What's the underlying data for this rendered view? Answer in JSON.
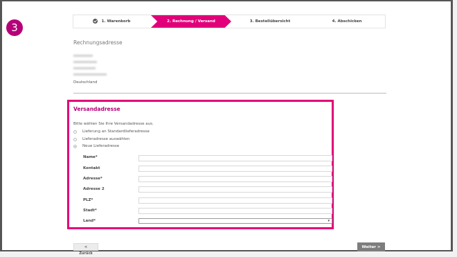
{
  "badge": "3",
  "stepper": {
    "steps": [
      {
        "label": "1. Warenkorb",
        "state": "done"
      },
      {
        "label": "2. Rechnung / Versand",
        "state": "active"
      },
      {
        "label": "3. Bestellübersicht",
        "state": "upcoming"
      },
      {
        "label": "4. Abschicken",
        "state": "upcoming"
      }
    ],
    "active_color": "#e2007a"
  },
  "billing": {
    "title": "Rechnungsadresse",
    "country": "Deutschland"
  },
  "shipping": {
    "title": "Versandadresse",
    "hint": "Bitte wählen Sie Ihre Versandadresse aus.",
    "options": [
      {
        "label": "Lieferung an Standardlieferadresse",
        "selected": false
      },
      {
        "label": "Lieferadresse auswählen",
        "selected": false
      },
      {
        "label": "Neue Lieferadresse",
        "selected": true
      }
    ],
    "fields": [
      {
        "label": "Name*",
        "value": ""
      },
      {
        "label": "Kontakt",
        "value": ""
      },
      {
        "label": "Adresse*",
        "value": ""
      },
      {
        "label": "Adresse 2",
        "value": ""
      },
      {
        "label": "PLZ*",
        "value": ""
      },
      {
        "label": "Stadt*",
        "value": ""
      }
    ],
    "country_field": {
      "label": "Land*",
      "value": ""
    },
    "highlight_color": "#e2007a"
  },
  "nav": {
    "back": "< Zurück",
    "next": "Weiter >"
  }
}
